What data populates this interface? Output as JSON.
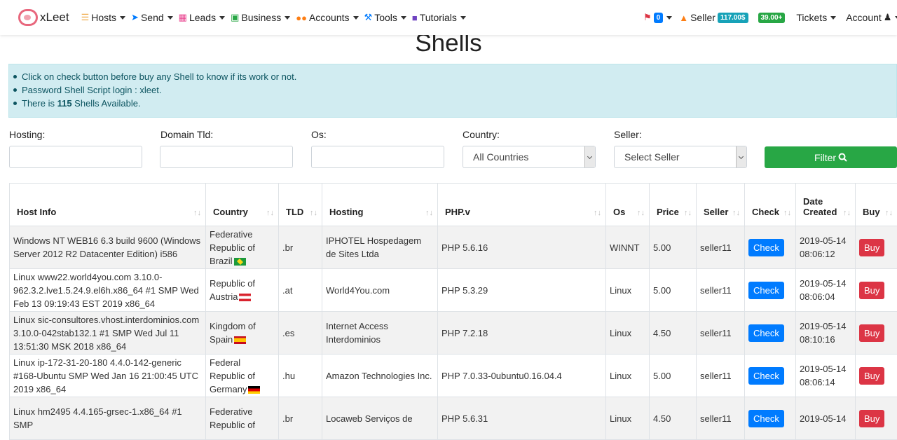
{
  "brand": {
    "name": "xLeet"
  },
  "nav": {
    "items": [
      {
        "label": "Hosts",
        "icon": "server-icon",
        "color": "#f0ad4e"
      },
      {
        "label": "Send",
        "icon": "paper-plane-icon",
        "color": "#007bff"
      },
      {
        "label": "Leads",
        "icon": "address-book-icon",
        "color": "#e83e8c"
      },
      {
        "label": "Business",
        "icon": "briefcase-icon",
        "color": "#28a745"
      },
      {
        "label": "Accounts",
        "icon": "users-icon",
        "color": "#fd7e14"
      },
      {
        "label": "Tools",
        "icon": "wrench-icon",
        "color": "#007bff"
      },
      {
        "label": "Tutorials",
        "icon": "book-icon",
        "color": "#6f42c1"
      }
    ],
    "notifications_count": "0",
    "seller_label": "Seller",
    "seller_balance": "117.00$",
    "balance": "39.00",
    "tickets_label": "Tickets",
    "account_label": "Account"
  },
  "page": {
    "title": "Shells"
  },
  "alert": {
    "line1": "Click on check button before buy any Shell to know if its work or not.",
    "line2": "Password Shell Script login : xleet.",
    "line3_prefix": "There is ",
    "line3_count": "115",
    "line3_suffix": " Shells Available."
  },
  "filters": {
    "hosting_label": "Hosting:",
    "domain_tld_label": "Domain Tld:",
    "os_label": "Os:",
    "country_label": "Country:",
    "country_value": "All Countries",
    "seller_label": "Seller:",
    "seller_value": "Select Seller",
    "filter_button": "Filter"
  },
  "table": {
    "headers": {
      "host_info": "Host Info",
      "country": "Country",
      "tld": "TLD",
      "hosting": "Hosting",
      "php": "PHP.v",
      "os": "Os",
      "price": "Price",
      "seller": "Seller",
      "check": "Check",
      "date_created_1": "Date",
      "date_created_2": "Created",
      "buy": "Buy"
    },
    "check_label": "Check",
    "buy_label": "Buy",
    "rows": [
      {
        "host_info": "Windows NT WEB16 6.3 build 9600 (Windows Server 2012 R2 Datacenter Edition) i586",
        "country": "Federative Republic of Brazil",
        "flag": "br",
        "tld": ".br",
        "hosting": "IPHOTEL Hospedagem de Sites Ltda",
        "php": "PHP 5.6.16",
        "os": "WINNT",
        "price": "5.00",
        "seller": "seller11",
        "date": "2019-05-14",
        "time": "08:06:12"
      },
      {
        "host_info": "Linux www22.world4you.com 3.10.0-962.3.2.lve1.5.24.9.el6h.x86_64 #1 SMP Wed Feb 13 09:19:43 EST 2019 x86_64",
        "country": "Republic of Austria",
        "flag": "at",
        "tld": ".at",
        "hosting": "World4You.com",
        "php": "PHP 5.3.29",
        "os": "Linux",
        "price": "5.00",
        "seller": "seller11",
        "date": "2019-05-14",
        "time": "08:06:04"
      },
      {
        "host_info": "Linux sic-consultores.vhost.interdominios.com 3.10.0-042stab132.1 #1 SMP Wed Jul 11 13:51:30 MSK 2018 x86_64",
        "country": "Kingdom of Spain",
        "flag": "es",
        "tld": ".es",
        "hosting": "Internet Access Interdominios",
        "php": "PHP 7.2.18",
        "os": "Linux",
        "price": "4.50",
        "seller": "seller11",
        "date": "2019-05-14",
        "time": "08:10:16"
      },
      {
        "host_info": "Linux ip-172-31-20-180 4.4.0-142-generic #168-Ubuntu SMP Wed Jan 16 21:00:45 UTC 2019 x86_64",
        "country": "Federal Republic of Germany",
        "flag": "de",
        "tld": ".hu",
        "hosting": "Amazon Technologies Inc.",
        "php": "PHP 7.0.33-0ubuntu0.16.04.4",
        "os": "Linux",
        "price": "5.00",
        "seller": "seller11",
        "date": "2019-05-14",
        "time": "08:06:14"
      },
      {
        "host_info": "Linux hm2495 4.4.165-grsec-1.x86_64 #1 SMP",
        "country": "Federative Republic of",
        "flag": "br",
        "tld": ".br",
        "hosting": "Locaweb Serviços de",
        "php": "PHP 5.6.31",
        "os": "Linux",
        "price": "4.50",
        "seller": "seller11",
        "date": "2019-05-14",
        "time": ""
      }
    ]
  }
}
